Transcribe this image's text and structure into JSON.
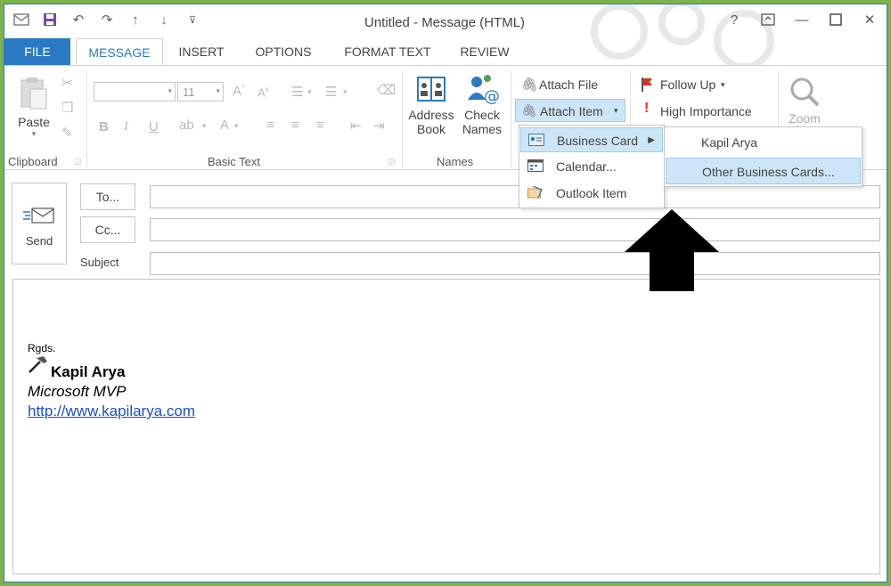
{
  "window": {
    "title": "Untitled - Message (HTML)"
  },
  "tabs": [
    "FILE",
    "MESSAGE",
    "INSERT",
    "OPTIONS",
    "FORMAT TEXT",
    "REVIEW"
  ],
  "ribbon": {
    "clipboard": {
      "label": "Clipboard",
      "paste": "Paste"
    },
    "basic_text": {
      "label": "Basic Text",
      "font_size": "11"
    },
    "names": {
      "label": "Names",
      "address_book_1": "Address",
      "address_book_2": "Book",
      "check_names_1": "Check",
      "check_names_2": "Names"
    },
    "include": {
      "attach_file": "Attach File",
      "attach_item": "Attach Item"
    },
    "tags": {
      "follow_up": "Follow Up",
      "high_importance": "High Importance"
    },
    "zoom": {
      "label": "Zoom"
    }
  },
  "menus": {
    "attach_item": [
      "Business Card",
      "Calendar...",
      "Outlook Item"
    ],
    "business_card": [
      "Kapil Arya",
      "Other Business Cards..."
    ]
  },
  "compose": {
    "send": "Send",
    "to": "To...",
    "cc": "Cc...",
    "subject": "Subject"
  },
  "signature": {
    "greeting": "Rgds.",
    "name": "Kapil Arya",
    "title": "Microsoft MVP",
    "url": "http://www.kapilarya.com"
  },
  "colors": {
    "accent": "#2b79c2",
    "menu_highlight": "#cde6f7",
    "background": "#7fb24a"
  }
}
